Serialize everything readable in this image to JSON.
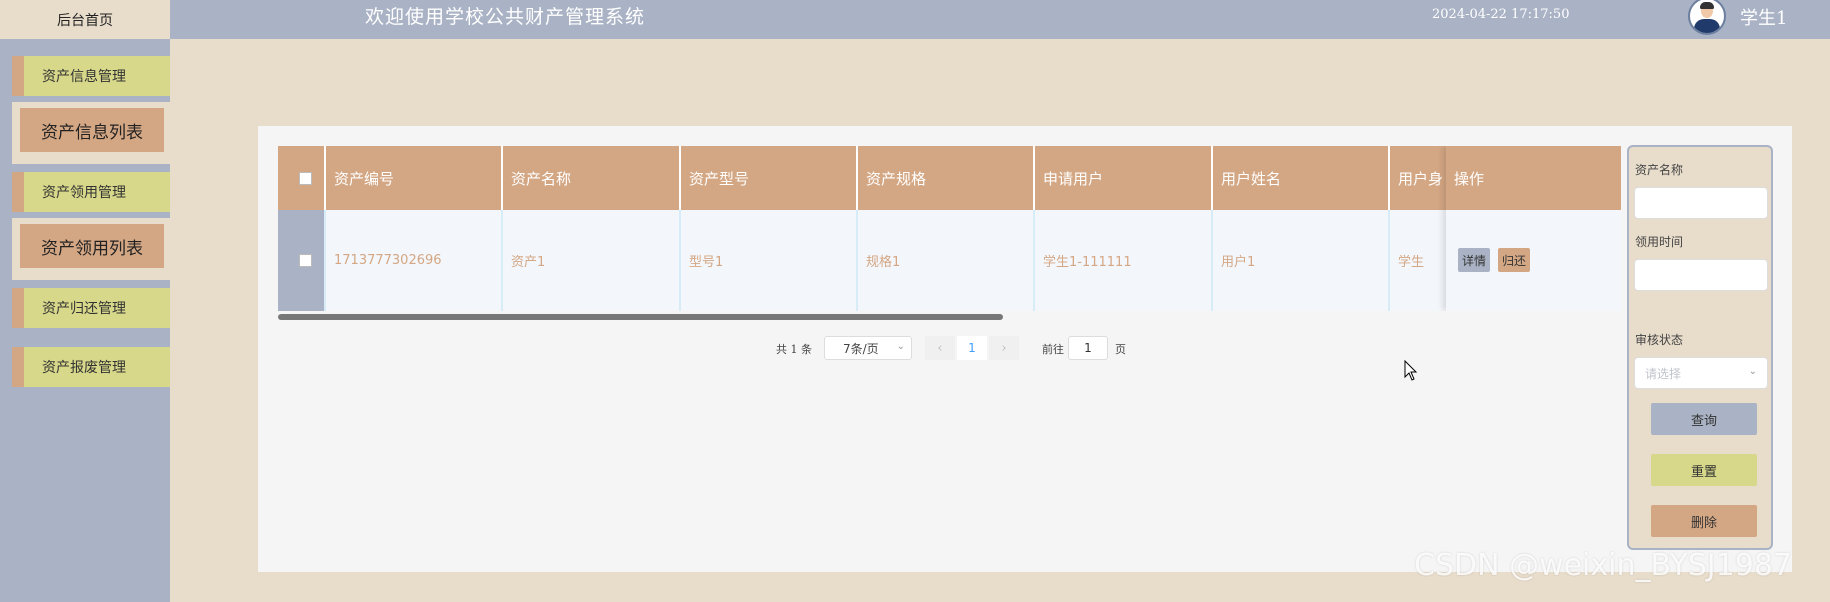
{
  "header": {
    "home_label": "后台首页",
    "title": "欢迎使用学校公共财产管理系统",
    "datetime": "2024-04-22 17:17:50",
    "avatar_icon": "user-avatar-icon",
    "username": "学生1"
  },
  "sidebar": {
    "items": [
      {
        "label": "资产信息管理"
      },
      {
        "label": "资产信息列表"
      },
      {
        "label": "资产领用管理"
      },
      {
        "label": "资产领用列表"
      },
      {
        "label": "资产归还管理"
      },
      {
        "label": "资产报废管理"
      }
    ]
  },
  "table": {
    "columns": [
      "资产编号",
      "资产名称",
      "资产型号",
      "资产规格",
      "申请用户",
      "用户姓名",
      "用户身",
      "操作"
    ],
    "rows": [
      {
        "code": "1713777302696",
        "name": "资产1",
        "model": "型号1",
        "spec": "规格1",
        "applicant": "学生1-111111",
        "realname": "用户1",
        "identity": "学生",
        "detail_btn": "详情",
        "return_btn": "归还"
      }
    ]
  },
  "pagination": {
    "total_text": "共 1 条",
    "page_size": "7条/页",
    "prev_icon": "chevron-left-icon",
    "current_page": "1",
    "next_icon": "chevron-right-icon",
    "goto_prefix": "前往",
    "goto_value": "1",
    "goto_suffix": "页"
  },
  "search": {
    "asset_name_label": "资产名称",
    "asset_name_value": "",
    "collect_time_label": "领用时间",
    "collect_time_value": "",
    "status_label": "审核状态",
    "status_placeholder": "请选择",
    "query_btn": "查询",
    "reset_btn": "重置",
    "delete_btn": "删除"
  },
  "watermark": "CSDN @weixin_BYSJ1987",
  "colors": {
    "topbar": "#aab3c5",
    "page_bg": "#e8dccb",
    "accent_tan": "#d4a784",
    "accent_green": "#d7d88a"
  }
}
